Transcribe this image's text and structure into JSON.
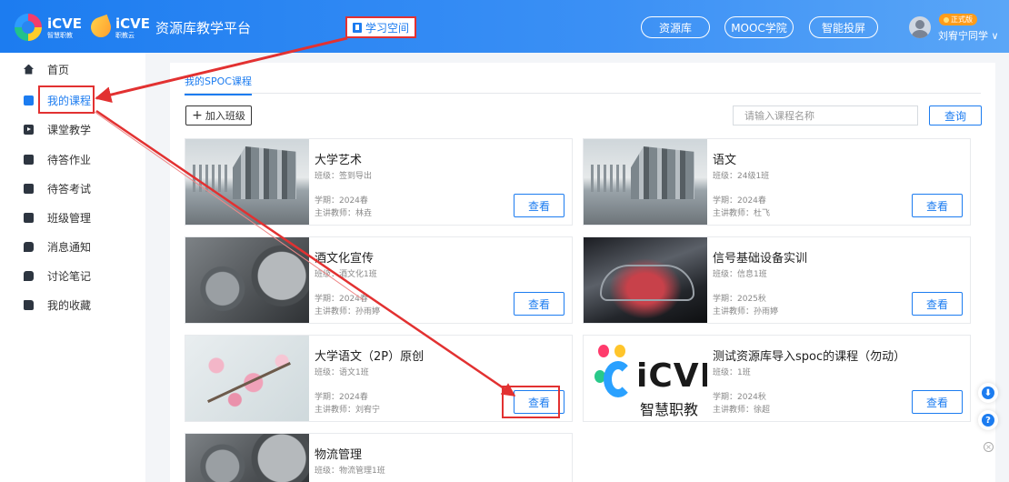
{
  "header": {
    "logo_brand": "iCVE",
    "logo_sub": "智慧职教",
    "logo2_brand": "iCVE",
    "logo2_sub": "职教云",
    "platform_name": "资源库教学平台",
    "study_space_label": "学习空间",
    "nav_pills": [
      "资源库",
      "MOOC学院",
      "智能投屏"
    ],
    "badge_label": "正式版",
    "username": "刘宥宁同学",
    "username_caret": "∨"
  },
  "sidebar": {
    "items": [
      {
        "label": "首页",
        "icon": "home-icon"
      },
      {
        "label": "我的课程",
        "icon": "course-icon"
      },
      {
        "label": "课堂教学",
        "icon": "play-icon"
      },
      {
        "label": "待答作业",
        "icon": "homework-icon"
      },
      {
        "label": "待答考试",
        "icon": "exam-icon"
      },
      {
        "label": "班级管理",
        "icon": "class-icon"
      },
      {
        "label": "消息通知",
        "icon": "message-icon"
      },
      {
        "label": "讨论笔记",
        "icon": "notes-icon"
      },
      {
        "label": "我的收藏",
        "icon": "favorite-icon"
      }
    ]
  },
  "main": {
    "tab_label": "我的SPOC课程",
    "add_class_label": "加入班级",
    "add_class_plus": "+",
    "search_placeholder": "请输入课程名称",
    "search_button": "查询",
    "view_label": "查看",
    "courses": [
      {
        "title": "大学艺术",
        "class": "班级：签到导出",
        "term": "学期：2024春",
        "teacher": "主讲教师：林垚"
      },
      {
        "title": "语文",
        "class": "班级：24级1班",
        "term": "学期：2024春",
        "teacher": "主讲教师：杜飞"
      },
      {
        "title": "酒文化宣传",
        "class": "班级：酒文化1班",
        "term": "学期：2024春",
        "teacher": "主讲教师：孙雨婷"
      },
      {
        "title": "信号基础设备实训",
        "class": "班级：信息1班",
        "term": "学期：2025秋",
        "teacher": "主讲教师：孙雨婷"
      },
      {
        "title": "大学语文（2P）原创",
        "class": "班级：语文1班",
        "term": "学期：2024春",
        "teacher": "主讲教师：刘宥宁"
      },
      {
        "title": "测试资源库导入spoc的课程（勿动）",
        "class": "班级：1班",
        "term": "学期：2024秋",
        "teacher": "主讲教师：徐超"
      },
      {
        "title": "物流管理",
        "class": "班级：物流管理1班"
      }
    ],
    "thumb_brand": "iCVE",
    "thumb_brand_cn": "智慧职教"
  },
  "floating": {
    "download_glyph": "⬇",
    "help_glyph": "?",
    "close_glyph": "×"
  },
  "colors": {
    "primary": "#1c7cf0",
    "annotation_red": "#e23131",
    "badge_orange": "#ff9c1a"
  }
}
